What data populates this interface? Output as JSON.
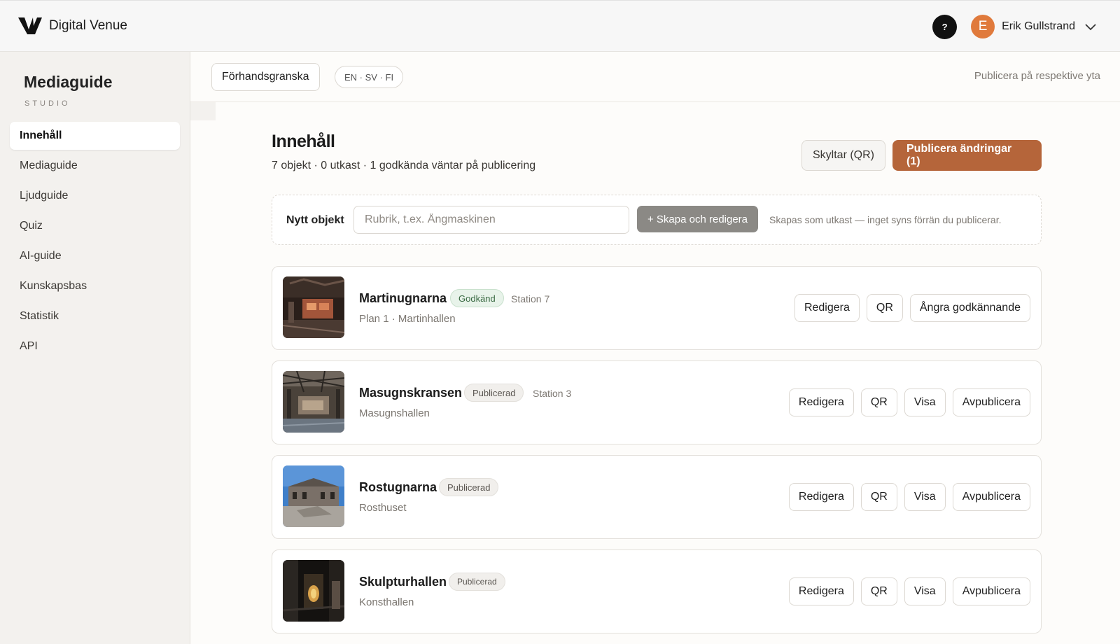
{
  "topbar": {
    "brand": "Digital Venue",
    "help_label": "?",
    "user_initial": "E",
    "user_name": "Erik Gullstrand"
  },
  "sidebar": {
    "title": "Mediaguide",
    "subtitle": "STUDIO",
    "items": [
      {
        "label": "Innehåll",
        "active": true
      },
      {
        "label": "Mediaguide"
      },
      {
        "label": "Ljudguide"
      },
      {
        "label": "Quiz"
      },
      {
        "label": "AI-guide"
      },
      {
        "label": "Kunskapsbas"
      },
      {
        "label": "Statistik"
      },
      {
        "label": "API"
      }
    ]
  },
  "subbar": {
    "preview_label": "Förhandsgranska",
    "languages": "EN · SV · FI",
    "publish_hint": "Publicera på respektive yta"
  },
  "main": {
    "title": "Innehåll",
    "stats": "7 objekt · 0 utkast · 1 godkända väntar på publicering",
    "signs_button": "Skyltar (QR)",
    "publish_button": "Publicera ändringar (1)"
  },
  "new_object": {
    "label": "Nytt objekt",
    "placeholder": "Rubrik, t.ex. Ångmaskinen",
    "value": "",
    "create_button": "+ Skapa och redigera",
    "hint": "Skapas som utkast — inget syns förrän du publicerar."
  },
  "items": [
    {
      "title": "Martinugnarna",
      "status": "Godkänd",
      "station": "Station 7",
      "subtitle": "Plan 1 · Martinhallen",
      "actions": [
        "Redigera",
        "QR",
        "Ångra godkännande"
      ]
    },
    {
      "title": "Masugnskransen",
      "status": "Publicerad",
      "station": "Station 3",
      "subtitle": "Masugnshallen",
      "actions": [
        "Redigera",
        "QR",
        "Visa",
        "Avpublicera"
      ]
    },
    {
      "title": "Rostugnarna",
      "status": "Publicerad",
      "station": "",
      "subtitle": "Rosthuset",
      "actions": [
        "Redigera",
        "QR",
        "Visa",
        "Avpublicera"
      ]
    },
    {
      "title": "Skulpturhallen",
      "status": "Publicerad",
      "station": "",
      "subtitle": "Konsthallen",
      "actions": [
        "Redigera",
        "QR",
        "Visa",
        "Avpublicera"
      ]
    }
  ],
  "colors": {
    "accent": "#b5653a",
    "avatar": "#e07a3c",
    "approved_badge": "#e8f3ea"
  }
}
